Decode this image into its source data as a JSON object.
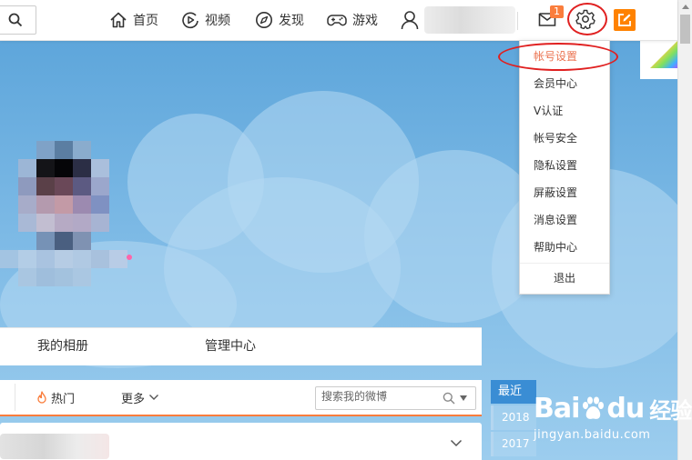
{
  "topbar": {
    "search_icon": "search-icon",
    "nav": [
      {
        "icon": "home-icon",
        "label": "首页"
      },
      {
        "icon": "video-icon",
        "label": "视频"
      },
      {
        "icon": "compass-icon",
        "label": "发现"
      },
      {
        "icon": "gamepad-icon",
        "label": "游戏"
      }
    ],
    "user_icon": "user-icon",
    "message_badge": "1",
    "accent_color": "#fa7d3c",
    "compose_color": "#ff8200"
  },
  "settings_menu": {
    "items": [
      "帐号设置",
      "会员中心",
      "V认证",
      "帐号安全",
      "隐私设置",
      "屏蔽设置",
      "消息设置",
      "帮助中心"
    ],
    "active_item": "帐号设置",
    "logout": "退出"
  },
  "profile_tabs": [
    "我的相册",
    "管理中心"
  ],
  "feed": {
    "hot": "热门",
    "more": "更多",
    "search_placeholder": "搜索我的微博"
  },
  "timeline": {
    "header": "最近",
    "years": [
      "2018",
      "2017"
    ]
  },
  "watermark": {
    "brand_left": "Bai",
    "brand_mid": "du",
    "brand_right": "经验",
    "site": "jingyan.baidu.com"
  }
}
